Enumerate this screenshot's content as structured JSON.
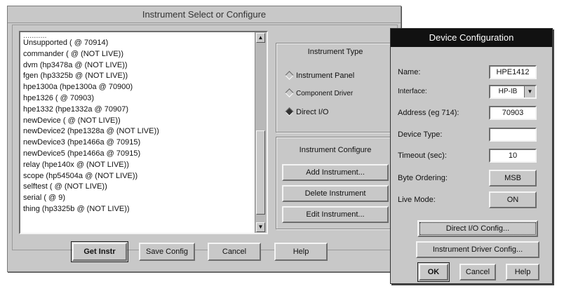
{
  "main": {
    "title": "Instrument Select or Configure",
    "partial_item": "...........",
    "instruments": [
      "Unsupported ( @ 70914)",
      "commander ( @ (NOT LIVE))",
      "dvm (hp3478a @ (NOT LIVE))",
      "fgen (hp3325b @ (NOT LIVE))",
      "hpe1300a (hpe1300a @ 70900)",
      "hpe1326 ( @ 70903)",
      "hpe1332 (hpe1332a @ 70907)",
      "newDevice ( @ (NOT LIVE))",
      "newDevice2 (hpe1328a @ (NOT LIVE))",
      "newDevice3 (hpe1466a @ 70915)",
      "newDevice5 (hpe1466a @ 70915)",
      "relay (hpe140x @ (NOT LIVE))",
      "scope (hp54504a @ (NOT LIVE))",
      "selftest ( @ (NOT LIVE))",
      "serial ( @ 9)",
      "thing (hp3325b @ (NOT LIVE))"
    ],
    "instrument_type": {
      "title": "Instrument Type",
      "options": [
        "Instrument Panel",
        "Component Driver",
        "Direct I/O"
      ],
      "selected": "Direct I/O"
    },
    "instrument_configure": {
      "title": "Instrument Configure",
      "add": "Add Instrument...",
      "delete": "Delete Instrument",
      "edit": "Edit Instrument..."
    },
    "buttons": {
      "get": "Get Instr",
      "save": "Save Config",
      "cancel": "Cancel",
      "help": "Help"
    }
  },
  "device": {
    "title": "Device Configuration",
    "labels": {
      "name": "Name:",
      "interface": "Interface:",
      "address": "Address (eg 714):",
      "device_type": "Device Type:",
      "timeout": "Timeout (sec):",
      "byte_ordering": "Byte Ordering:",
      "live_mode": "Live Mode:"
    },
    "values": {
      "name": "HPE1412",
      "interface": "HP-IB",
      "address": "70903",
      "device_type": "",
      "timeout": "10",
      "byte_ordering": "MSB",
      "live_mode": "ON"
    },
    "buttons": {
      "direct_io": "Direct I/O Config...",
      "driver": "Instrument Driver Config...",
      "ok": "OK",
      "cancel": "Cancel",
      "help": "Help"
    }
  },
  "icons": {
    "scroll_up": "▲",
    "scroll_down": "▼",
    "combo_arrow": "▼"
  }
}
